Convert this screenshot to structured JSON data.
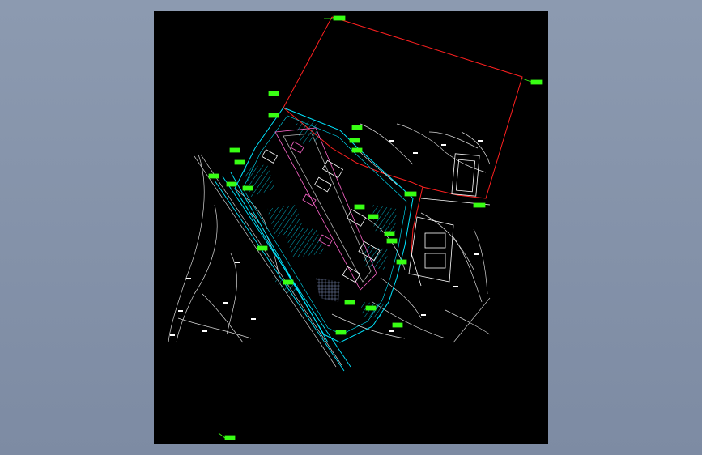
{
  "viewport": {
    "background_top": "#8c9ab0",
    "background_bottom": "#7d8ba3",
    "paper_color": "#000000"
  },
  "drawing": {
    "description_colors": {
      "boundary": "#ff2020",
      "contours": "#ffffff",
      "roads": "#00e5ff",
      "buildings": "#ff66cc",
      "labels": "#39ff14"
    }
  }
}
